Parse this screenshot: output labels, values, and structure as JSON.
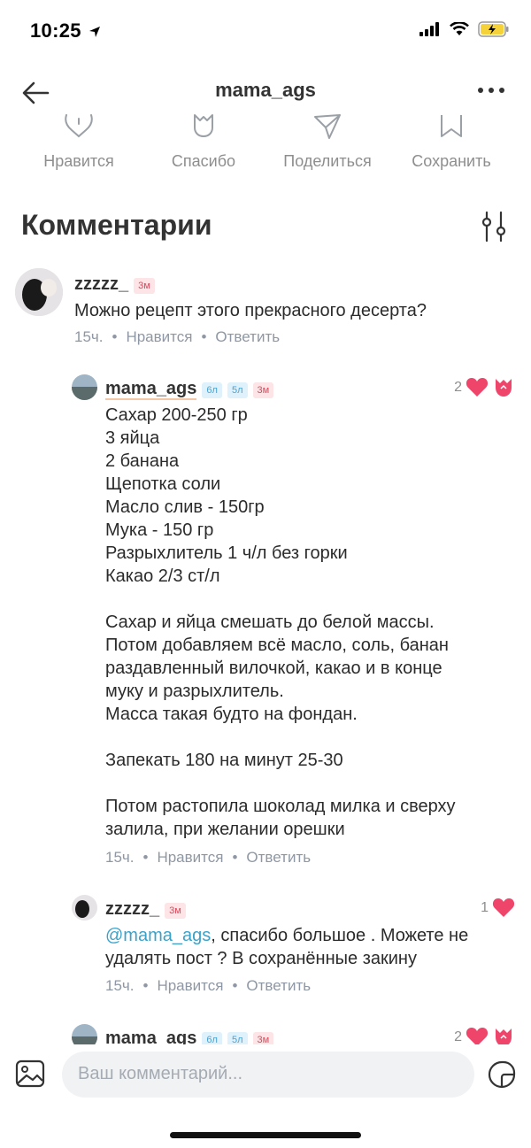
{
  "status_bar": {
    "time": "10:25"
  },
  "header": {
    "title": "mama_ags"
  },
  "actions": [
    {
      "label": "Нравится"
    },
    {
      "label": "Спасибо"
    },
    {
      "label": "Поделиться"
    },
    {
      "label": "Сохранить"
    }
  ],
  "comments_section": {
    "title": "Комментарии"
  },
  "comments": [
    {
      "username": "zzzzz_",
      "badges": [
        "3м"
      ],
      "text": "Можно рецепт этого прекрасного десерта?",
      "time": "15ч.",
      "like_label": "Нравится",
      "reply_label": "Ответить"
    },
    {
      "username": "mama_ags",
      "badges": [
        "6л",
        "5л",
        "3м"
      ],
      "text": "Сахар 200-250 гр\n3 яйца\n2 банана\nЩепотка соли\nМасло слив - 150гр\nМука - 150 гр\nРазрыхлитель 1 ч/л без горки\nКакао 2/3 ст/л\n\nСахар и яйца смешать до белой массы.\nПотом добавляем всё масло, соль, банан\nраздавленный вилочкой, какао и в конце\nмуку и разрыхлитель.\nМасса такая будто на фондан.\n\nЗапекать 180 на минут 25-30\n\nПотом растопила шоколад милка и сверху\nзалила, при желании орешки",
      "time": "15ч.",
      "like_label": "Нравится",
      "reply_label": "Ответить",
      "like_count": "2"
    },
    {
      "username": "zzzzz_",
      "badges": [
        "3м"
      ],
      "mention": "@mama_ags",
      "text": ", спасибо большое . Можете не\nудалять пост ? В сохранённые закину",
      "time": "15ч.",
      "like_label": "Нравится",
      "reply_label": "Ответить",
      "like_count": "1"
    },
    {
      "username": "mama_ags",
      "badges": [
        "6л",
        "5л",
        "3м"
      ],
      "like_count": "2"
    }
  ],
  "composer": {
    "placeholder": "Ваш комментарий..."
  },
  "colors": {
    "heart": "#f0456a",
    "mention": "#3aa2c9",
    "meta": "#8e97a3"
  },
  "icons": [
    "back-arrow-icon",
    "more-icon",
    "heart-icon",
    "thanks-icon",
    "share-icon",
    "bookmark-icon",
    "filter-icon",
    "image-icon",
    "sticker-icon"
  ]
}
